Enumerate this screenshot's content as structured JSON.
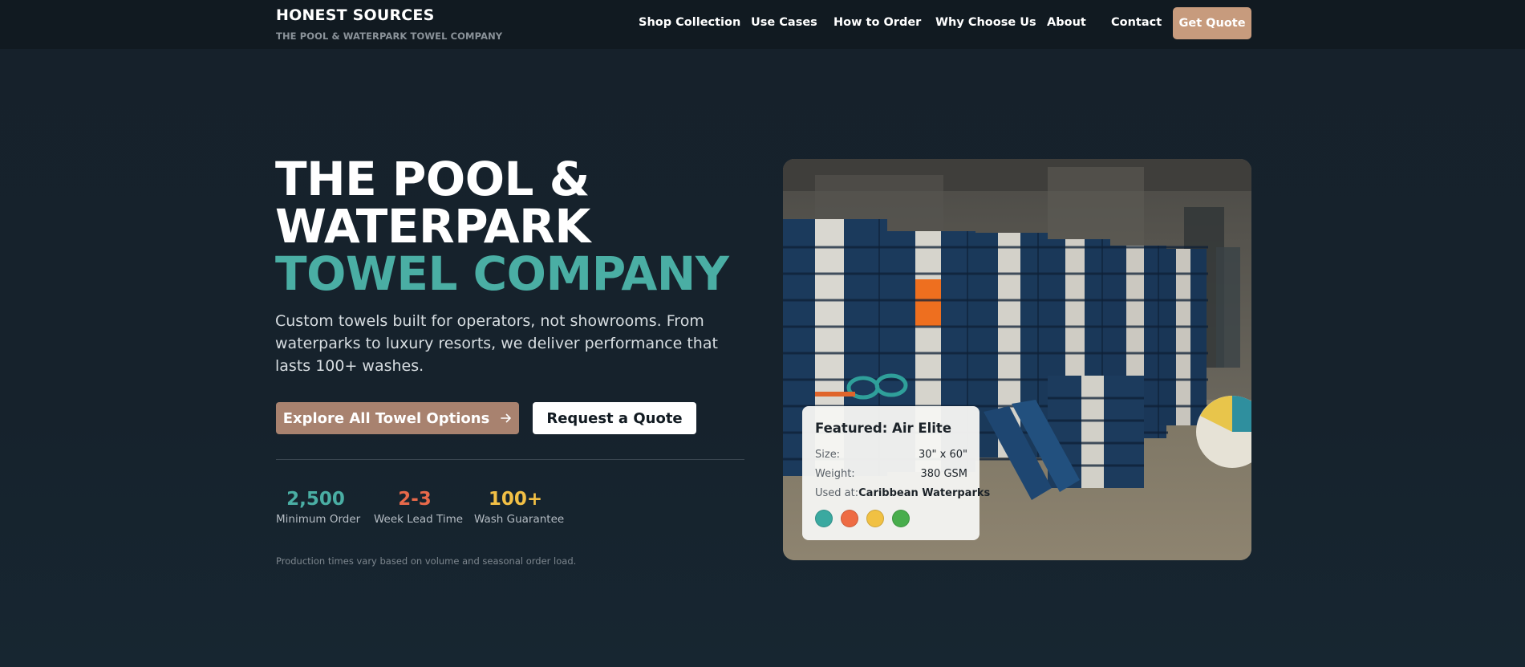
{
  "header": {
    "brand_name": "HONEST SOURCES",
    "brand_tagline": "THE POOL & WATERPARK TOWEL COMPANY",
    "nav": [
      "Shop Collection",
      "Use Cases",
      "How to Order",
      "Why Choose Us",
      "About",
      "Contact"
    ],
    "cta_label": "Get Quote"
  },
  "hero": {
    "headline_line1": "THE POOL &",
    "headline_line2": "WATERPARK",
    "headline_line3": "TOWEL COMPANY",
    "subcopy": "Custom towels built for operators, not showrooms. From waterparks to luxury resorts, we deliver performance that lasts 100+ washes.",
    "primary_button": "Explore All Towel Options",
    "primary_button_icon": "arrow-right-icon",
    "secondary_button": "Request a Quote",
    "stats": [
      {
        "value": "2,500",
        "label": "Minimum Order",
        "color": "#4aaea4"
      },
      {
        "value": "2-3",
        "label": "Week Lead Time",
        "color": "#e8694a"
      },
      {
        "value": "100+",
        "label": "Wash Guarantee",
        "color": "#f2c045"
      }
    ],
    "footnote": "Production times vary based on volume and seasonal order load."
  },
  "featured": {
    "title": "Featured: Air Elite",
    "size_label": "Size:",
    "size_value": "30\" x 60\"",
    "weight_label": "Weight:",
    "weight_value": "380 GSM",
    "used_label": "Used at:",
    "used_value": "Caribbean Waterparks",
    "swatches": [
      "#3aa9a0",
      "#ee6b43",
      "#f1c143",
      "#48ad4c"
    ]
  },
  "colors": {
    "accent_teal": "#4aaea4",
    "accent_tan": "#c79b7d",
    "button_brown": "#a8826f",
    "background": "#16212b"
  }
}
